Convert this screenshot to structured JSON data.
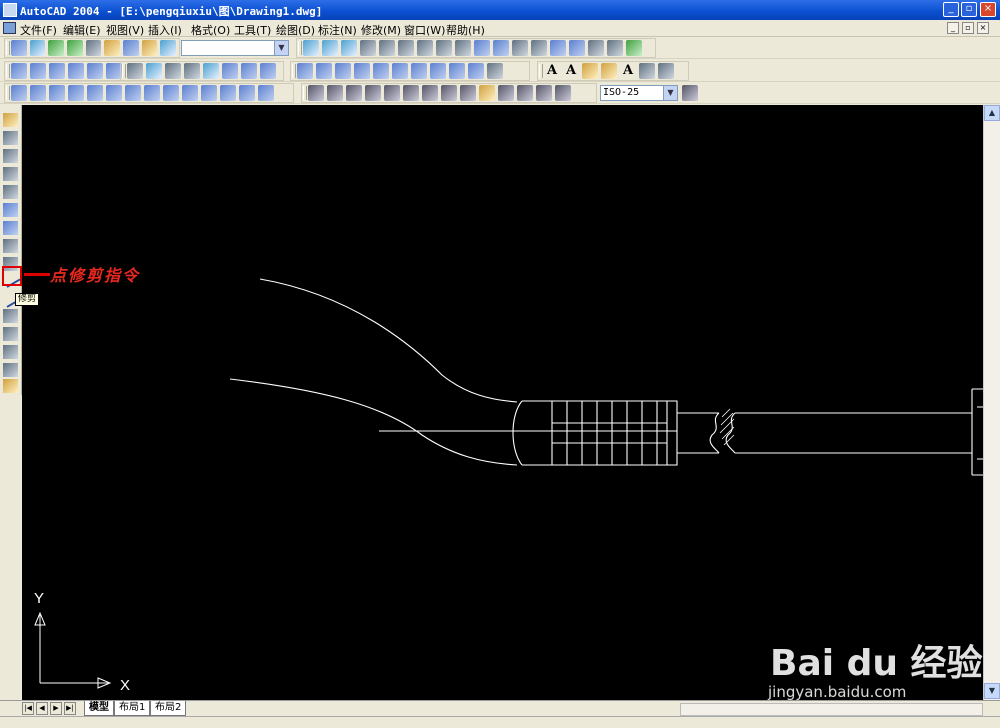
{
  "window": {
    "title": "AutoCAD 2004 - [E:\\pengqiuxiu\\图\\Drawing1.dwg]"
  },
  "menu": {
    "items": [
      "文件(F)",
      "编辑(E)",
      "视图(V)",
      "插入(I)",
      "格式(O)",
      "工具(T)",
      "绘图(D)",
      "标注(N)",
      "修改(M)",
      "窗口(W)",
      "帮助(H)"
    ]
  },
  "toolbar": {
    "dimstyle_value": "ISO-25",
    "text_letter": "A"
  },
  "annotation": {
    "text": "点修剪指令",
    "tooltip": "修剪"
  },
  "ucs": {
    "x_label": "X",
    "y_label": "Y"
  },
  "tabs": {
    "model": "模型",
    "layout1": "布局1",
    "layout2": "布局2"
  },
  "watermark": {
    "logo": "Bai du 经验",
    "url": "jingyan.baidu.com"
  },
  "colors": {
    "canvas": "#000000",
    "annotation": "#e8281e",
    "titlebar": "#0a4fd0"
  }
}
